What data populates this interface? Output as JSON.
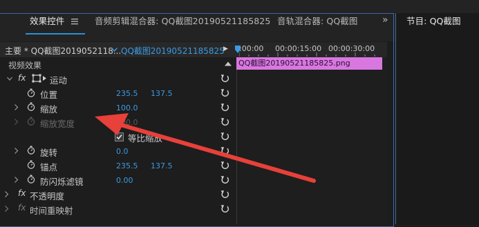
{
  "tabs": [
    {
      "label": "效果控件",
      "menu_icon": "hamburger-icon"
    },
    {
      "label": "音频剪辑混合器: QQ截图20190521185825"
    },
    {
      "label": "音轨混合器: QQ截图"
    },
    {
      "label": "节目: QQ截图"
    }
  ],
  "overflow_glyph": "»",
  "source": {
    "master": "主要 * QQ截图2019052118...",
    "sequence": "QQ截图20190521185825",
    "play_glyph": "▶"
  },
  "timeline": {
    "times": [
      ":00:00",
      "00:00:15:00",
      "00:00:30:00"
    ],
    "clip_label": "QQ截图20190521185825.png"
  },
  "section_label": "视频效果",
  "effects": [
    {
      "label": "运动",
      "fx": "fx"
    },
    {
      "label": "位置",
      "v1": "235.5",
      "v2": "137.5"
    },
    {
      "label": "缩放",
      "v1": "100.0"
    },
    {
      "label": "缩放宽度",
      "v1": "100.0"
    },
    {
      "label": "等比缩放",
      "checked": true
    },
    {
      "label": "旋转",
      "v1": "0.0"
    },
    {
      "label": "锚点",
      "v1": "235.5",
      "v2": "137.5"
    },
    {
      "label": "防闪烁滤镜",
      "v1": "0.00"
    },
    {
      "label": "不透明度",
      "fx": "fx"
    },
    {
      "label": "时间重映射",
      "fx": "fx"
    }
  ],
  "colors": {
    "accent": "#3b9ae1",
    "clip": "#d877e0",
    "arrow": "#e8403a"
  }
}
